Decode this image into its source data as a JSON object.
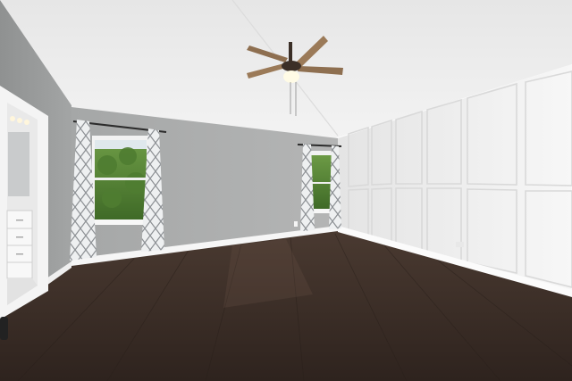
{
  "scene": {
    "kind": "empty-room-photo",
    "room": "vacant bedroom",
    "elements": [
      "vaulted-ceiling",
      "ceiling-fan",
      "back-wall",
      "left-wall",
      "right-paneled-wall",
      "left-window",
      "right-window",
      "patterned-curtains",
      "open-doorway-to-bathroom",
      "vanity-cabinet",
      "dark-hardwood-floor",
      "white-baseboards",
      "electrical-outlets"
    ]
  },
  "colors": {
    "ceiling": "#eeeeee",
    "back_wall": "#a9abab",
    "left_wall": "#9d9f9f",
    "paneled_wall": "#f2f2f2",
    "floor": "#3a2d26",
    "trim": "#fafafa",
    "foliage": "#4e7a2f",
    "fan_blade": "#9b7a58"
  }
}
